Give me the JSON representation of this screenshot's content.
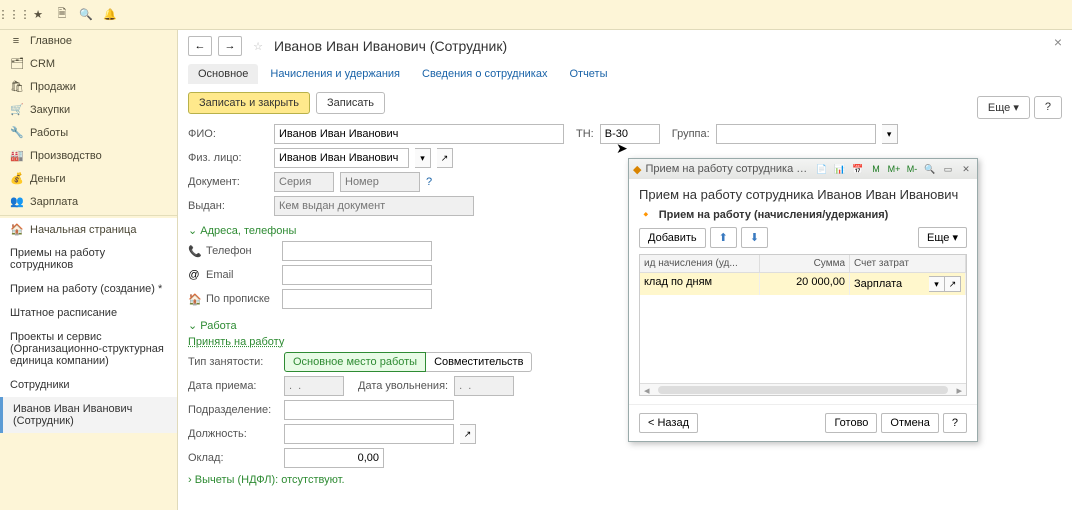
{
  "toolbar_icons": [
    "apps",
    "star",
    "doc",
    "search",
    "bell"
  ],
  "sidebar": {
    "sections": [
      {
        "icon": "≡",
        "label": "Главное"
      },
      {
        "icon": "🗂",
        "label": "CRM"
      },
      {
        "icon": "🛍",
        "label": "Продажи"
      },
      {
        "icon": "🛒",
        "label": "Закупки"
      },
      {
        "icon": "🔧",
        "label": "Работы"
      },
      {
        "icon": "🏭",
        "label": "Производство"
      },
      {
        "icon": "💰",
        "label": "Деньги"
      },
      {
        "icon": "👥",
        "label": "Зарплата"
      }
    ],
    "funcs": [
      {
        "icon": "🏠",
        "label": "Начальная страница",
        "home": true
      },
      {
        "label": "Приемы на работу сотрудников"
      },
      {
        "label": "Прием на работу (создание) *"
      },
      {
        "label": "Штатное расписание"
      },
      {
        "label": "Проекты и сервис (Организационно-структурная единица компании)"
      },
      {
        "label": "Сотрудники"
      },
      {
        "label": "Иванов Иван Иванович (Сотрудник)",
        "active": true
      }
    ]
  },
  "page": {
    "nav_back": "←",
    "nav_fwd": "→",
    "title": "Иванов Иван Иванович (Сотрудник)",
    "tabs": [
      {
        "label": "Основное",
        "active": true
      },
      {
        "label": "Начисления и удержания"
      },
      {
        "label": "Сведения о сотрудниках"
      },
      {
        "label": "Отчеты"
      }
    ],
    "actions": {
      "save_close": "Записать и закрыть",
      "save": "Записать",
      "more": "Еще",
      "help": "?"
    }
  },
  "form": {
    "fio": {
      "label": "ФИО:",
      "value": "Иванов Иван Иванович"
    },
    "tn": {
      "label": "ТН:",
      "value": "В-30"
    },
    "group": {
      "label": "Группа:",
      "value": ""
    },
    "phys": {
      "label": "Физ. лицо:",
      "value": "Иванов Иван Иванович"
    },
    "doc": {
      "label": "Документ:",
      "series_ph": "Серия",
      "number_ph": "Номер"
    },
    "issuer": {
      "label": "Выдан:",
      "placeholder": "Кем выдан документ"
    },
    "addresses": {
      "title": "Адреса, телефоны",
      "phone": {
        "icon": "📞",
        "label": "Телефон"
      },
      "email": {
        "icon": "@",
        "label": "Email"
      },
      "reg": {
        "icon": "🏠",
        "label": "По прописке"
      }
    },
    "work": {
      "title": "Работа",
      "hire_link": "Принять на работу",
      "emp_type": {
        "label": "Тип занятости:",
        "opt1": "Основное место работы",
        "opt2": "Совместительств"
      },
      "hire_date": {
        "label": "Дата приема:",
        "ph": ".  .  "
      },
      "fire_date": {
        "label": "Дата увольнения:",
        "ph": ".  .  "
      },
      "dept": {
        "label": "Подразделение:"
      },
      "position": {
        "label": "Должность:"
      },
      "salary": {
        "label": "Оклад:",
        "value": "0,00"
      }
    },
    "deductions": {
      "title": "Вычеты (НДФЛ): отсутствуют."
    }
  },
  "popup": {
    "window_title": "Прием на работу сотрудника Иванов Иван Иванович",
    "title": "Прием на работу сотрудника Иванов Иван Иванович",
    "subtitle": "Прием на работу (начисления/удержания)",
    "add": "Добавить",
    "more": "Еще",
    "columns": [
      "ид начисления (уд...",
      "Сумма",
      "Счет затрат"
    ],
    "rows": [
      {
        "c0": "клад по дням",
        "c1": "20 000,00",
        "c2": "Зарплата"
      }
    ],
    "back": "< Назад",
    "done": "Готово",
    "cancel": "Отмена",
    "help": "?"
  }
}
